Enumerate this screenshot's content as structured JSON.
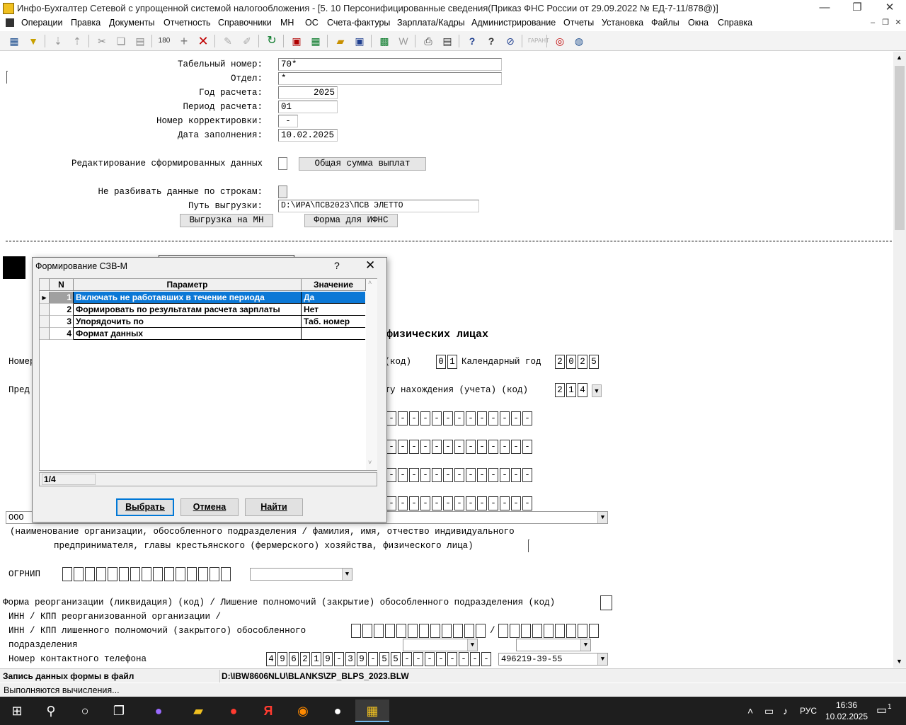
{
  "window": {
    "title": "Инфо-Бухгалтер Сетевой с упрощенной системой налогообложения - [5. 10 Персонифицированные сведения(Приказ ФНС России от 29.09.2022 № ЕД-7-11/878@)]",
    "minimize": "—",
    "restore": "❐",
    "close": "✕"
  },
  "menu": [
    "Операции",
    "Правка",
    "Документы",
    "Отчетность",
    "Справочники",
    "МН",
    "ОС",
    "Счета-фактуры",
    "Зарплата/Кадры",
    "Администрирование",
    "Отчеты",
    "Установка",
    "Файлы",
    "Окна",
    "Справка"
  ],
  "mdi_buttons": {
    "minimize": "‒",
    "restore": "❐",
    "close": "✕"
  },
  "form": {
    "tab_number_label": "Табельный номер:",
    "tab_number_value": "70*",
    "dept_label": "Отдел:",
    "dept_value": "*",
    "year_label": "Год расчета:",
    "year_value": "2025",
    "period_label": "Период расчета:",
    "period_value": "01",
    "correction_label": "Номер корректировки:",
    "correction_value": "-",
    "date_label": "Дата заполнения:",
    "date_value": "10.02.2025",
    "edit_label": "Редактирование сформированных данных",
    "total_button": "Общая сумма выплат",
    "nosplit_label": "Не разбивать данные по строкам:",
    "path_label": "Путь выгрузки:",
    "path_value": "D:\\ИРА\\ПСВ2023\\ПСВ ЭЛЕТТО",
    "export_button": "Выгрузка на МН",
    "ifns_button": "Форма для ИФНС"
  },
  "report": {
    "heading_fragment": "физических лицах",
    "nomer_fragment": "Номер",
    "period_code_label": "я(код)",
    "period_code": [
      "0",
      "1"
    ],
    "year_label": "Календарный год",
    "year_cells": [
      "2",
      "0",
      "2",
      "5"
    ],
    "pred_fragment": "Пред",
    "location_label": "сту нахождения (учета) (код)",
    "location_cells": [
      "2",
      "1",
      "4"
    ],
    "org_value": "ООО",
    "org_caption_1": "(наименование организации, обособленного подразделения  / фамилия, имя, отчество   индивидуального",
    "org_caption_2": "предпринимателя, главы крестьянского (фермерского) хозяйства, физического лица)",
    "ogrnip_label": "ОГРНИП",
    "reorg_label": "Форма реорганизации (ликвидация) (код) / Лишение полномочий (закрытие) обособленного подразделения (код)",
    "inn_label_1": "ИНН / КПП реорганизованной организации /",
    "inn_label_2": "ИНН / КПП лишенного полномочий (закрытого) обособленного",
    "inn_label_3": "подразделения",
    "phone_label": "Номер контактного телефона",
    "phone_cells": [
      "4",
      "9",
      "6",
      "2",
      "1",
      "9",
      "-",
      "3",
      "9",
      "-",
      "5",
      "5",
      "-",
      "-",
      "-",
      "-",
      "-",
      "-",
      "-",
      "-"
    ],
    "phone_value": "496219-39-55",
    "slash": "/"
  },
  "dialog": {
    "title": "Формирование СЗВ-М",
    "help": "?",
    "close": "✕",
    "columns": {
      "n": "N",
      "param": "Параметр",
      "value": "Значение"
    },
    "rows": [
      {
        "n": "1",
        "param": "Включать не работавших в течение периода",
        "value": "Да"
      },
      {
        "n": "2",
        "param": "Формировать по результатам расчета зарплаты",
        "value": "Нет"
      },
      {
        "n": "3",
        "param": "Упорядочить по",
        "value": "Таб. номер"
      },
      {
        "n": "4",
        "param": "Формат данных",
        "value": ""
      }
    ],
    "counter": "1/4",
    "select_button": "Выбрать",
    "cancel_button": "Отмена",
    "find_button": "Найти"
  },
  "status": {
    "left": "Запись данных формы в файл",
    "right": "D:\\IBW8606NLU\\BLANKS\\ZP_BLPS_2023.BLW",
    "bottom": "Выполняются вычисления..."
  },
  "taskbar": {
    "lang": "РУС",
    "time": "16:36",
    "date": "10.02.2025",
    "notif_count": "1"
  }
}
